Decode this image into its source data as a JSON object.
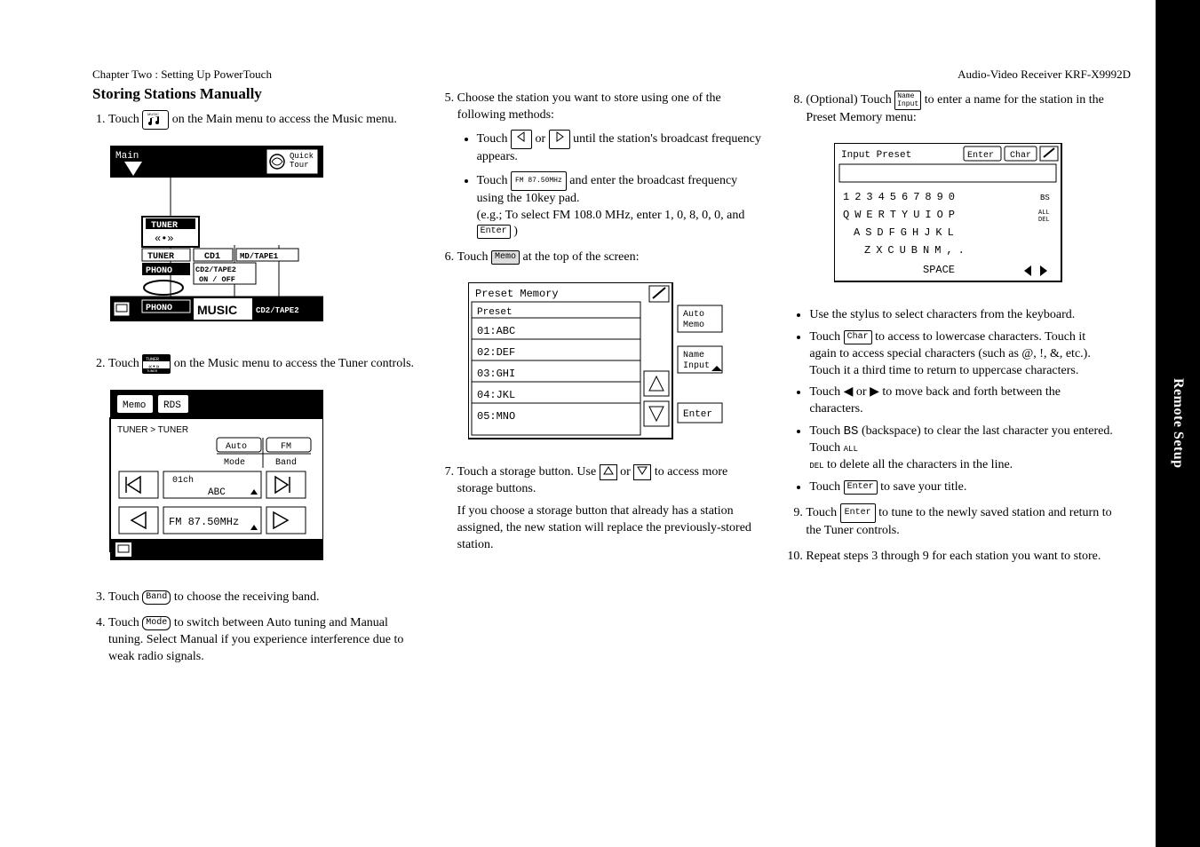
{
  "header": {
    "left": "Chapter Two : Setting Up PowerTouch",
    "right": "Audio-Video Receiver KRF-X9992D"
  },
  "side_tab": "Remote Setup",
  "title": "Storing Stations Manually",
  "col1": {
    "step1_a": "Touch ",
    "step1_b": " on the Main menu to access the Music menu.",
    "fig1": {
      "main": "Main",
      "quick": "Quick\nTour",
      "tuner": "TUNER",
      "cd1": "CD1",
      "mdtape1": "MD/TAPE1",
      "phono": "PHONO",
      "cd2tape2": "CD2/TAPE2\nON / OFF",
      "music": "MUSIC",
      "cd2tape2b": "CD2/TAPE2"
    },
    "step2_a": "Touch ",
    "step2_b": " on the Music menu to access the Tuner controls.",
    "fig2": {
      "memo": "Memo",
      "rds": "RDS",
      "breadcrumb": "TUNER > TUNER",
      "auto": "Auto",
      "fm": "FM",
      "mode": "Mode",
      "band": "Band",
      "ch": "01ch",
      "chname": "ABC",
      "freq": "FM 87.50MHz"
    },
    "step3_a": "Touch ",
    "step3_btn": "Band",
    "step3_b": " to choose the receiving band.",
    "step4_a": "Touch ",
    "step4_btn": "Mode",
    "step4_b": " to switch between Auto tuning and Manual tuning. Select Manual if you experience interference due to weak radio signals."
  },
  "col2": {
    "step5": "Choose the station you want to store using one of the following methods:",
    "step5_b1_a": "Touch ",
    "step5_b1_b": " or ",
    "step5_b1_c": " until the station's broadcast frequency appears.",
    "step5_b2_a": "Touch ",
    "step5_b2_label": "FM 87.50MHz",
    "step5_b2_b": " and enter the broadcast frequency using the 10key pad.",
    "step5_b2_c": "(e.g.; To select FM 108.0 MHz, enter 1, 0, 8, 0, 0, and ",
    "step5_b2_enter": "Enter",
    "step5_b2_d": " )",
    "step6_a": "Touch ",
    "step6_btn": "Memo",
    "step6_b": " at the top of the screen:",
    "fig3": {
      "title": "Preset Memory",
      "header": "Preset",
      "rows": [
        "01:ABC",
        "02:DEF",
        "03:GHI",
        "04:JKL",
        "05:MNO"
      ],
      "auto_memo": "Auto\nMemo",
      "name_input": "Name\nInput",
      "enter": "Enter"
    },
    "step7_a": "Touch a storage button. Use ",
    "step7_b": " or ",
    "step7_c": " to access more storage buttons.",
    "step7_note": "If you choose a storage button that already has a station assigned, the new station will replace the previously-stored station."
  },
  "col3": {
    "step8_a": "(Optional) Touch ",
    "step8_btn": "Name\nInput",
    "step8_b": " to enter a name for the station in the Preset Memory menu:",
    "fig4": {
      "title": "Input Preset",
      "enter": "Enter",
      "char": "Char",
      "row1": "1 2 3 4 5 6 7 8 9 0 BS",
      "row2": "Q W E R T Y U I O P ALL\nDEL",
      "row3": "A S D F G H J K L",
      "row4": "Z X C U B N M , .",
      "space": "SPACE"
    },
    "b1": "Use the stylus to select characters from the keyboard.",
    "b2_a": "Touch ",
    "b2_btn": "Char",
    "b2_b": " to access to lowercase characters. Touch it again to access special characters (such as @, !, &, etc.). Touch it a third time to return to uppercase characters.",
    "b3_a": "Touch ",
    "b3_b": " or ",
    "b3_c": " to move back and forth between the characters.",
    "b4_a": "Touch ",
    "b4_bs": "BS",
    "b4_b": " (backspace) to clear the last character you entered. Touch ",
    "b4_alldel": "ALL DEL",
    "b4_c": " to delete all the characters in the line.",
    "b5_a": "Touch ",
    "b5_btn": "Enter",
    "b5_b": " to save your title.",
    "step9_a": "Touch ",
    "step9_btn": "Enter",
    "step9_b": " to tune to the newly saved station and return to the Tuner controls.",
    "step10": "Repeat steps 3 through 9 for each station you want to store."
  }
}
